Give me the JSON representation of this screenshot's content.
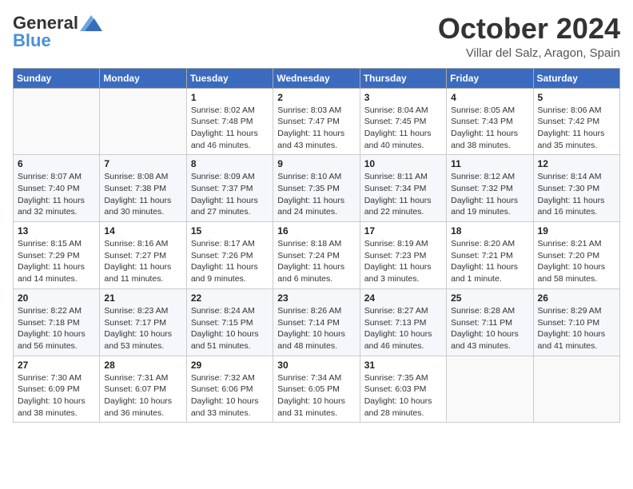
{
  "header": {
    "logo_general": "General",
    "logo_blue": "Blue",
    "month_year": "October 2024",
    "location": "Villar del Salz, Aragon, Spain"
  },
  "days_of_week": [
    "Sunday",
    "Monday",
    "Tuesday",
    "Wednesday",
    "Thursday",
    "Friday",
    "Saturday"
  ],
  "weeks": [
    [
      {
        "day": "",
        "detail": ""
      },
      {
        "day": "",
        "detail": ""
      },
      {
        "day": "1",
        "detail": "Sunrise: 8:02 AM\nSunset: 7:48 PM\nDaylight: 11 hours and 46 minutes."
      },
      {
        "day": "2",
        "detail": "Sunrise: 8:03 AM\nSunset: 7:47 PM\nDaylight: 11 hours and 43 minutes."
      },
      {
        "day": "3",
        "detail": "Sunrise: 8:04 AM\nSunset: 7:45 PM\nDaylight: 11 hours and 40 minutes."
      },
      {
        "day": "4",
        "detail": "Sunrise: 8:05 AM\nSunset: 7:43 PM\nDaylight: 11 hours and 38 minutes."
      },
      {
        "day": "5",
        "detail": "Sunrise: 8:06 AM\nSunset: 7:42 PM\nDaylight: 11 hours and 35 minutes."
      }
    ],
    [
      {
        "day": "6",
        "detail": "Sunrise: 8:07 AM\nSunset: 7:40 PM\nDaylight: 11 hours and 32 minutes."
      },
      {
        "day": "7",
        "detail": "Sunrise: 8:08 AM\nSunset: 7:38 PM\nDaylight: 11 hours and 30 minutes."
      },
      {
        "day": "8",
        "detail": "Sunrise: 8:09 AM\nSunset: 7:37 PM\nDaylight: 11 hours and 27 minutes."
      },
      {
        "day": "9",
        "detail": "Sunrise: 8:10 AM\nSunset: 7:35 PM\nDaylight: 11 hours and 24 minutes."
      },
      {
        "day": "10",
        "detail": "Sunrise: 8:11 AM\nSunset: 7:34 PM\nDaylight: 11 hours and 22 minutes."
      },
      {
        "day": "11",
        "detail": "Sunrise: 8:12 AM\nSunset: 7:32 PM\nDaylight: 11 hours and 19 minutes."
      },
      {
        "day": "12",
        "detail": "Sunrise: 8:14 AM\nSunset: 7:30 PM\nDaylight: 11 hours and 16 minutes."
      }
    ],
    [
      {
        "day": "13",
        "detail": "Sunrise: 8:15 AM\nSunset: 7:29 PM\nDaylight: 11 hours and 14 minutes."
      },
      {
        "day": "14",
        "detail": "Sunrise: 8:16 AM\nSunset: 7:27 PM\nDaylight: 11 hours and 11 minutes."
      },
      {
        "day": "15",
        "detail": "Sunrise: 8:17 AM\nSunset: 7:26 PM\nDaylight: 11 hours and 9 minutes."
      },
      {
        "day": "16",
        "detail": "Sunrise: 8:18 AM\nSunset: 7:24 PM\nDaylight: 11 hours and 6 minutes."
      },
      {
        "day": "17",
        "detail": "Sunrise: 8:19 AM\nSunset: 7:23 PM\nDaylight: 11 hours and 3 minutes."
      },
      {
        "day": "18",
        "detail": "Sunrise: 8:20 AM\nSunset: 7:21 PM\nDaylight: 11 hours and 1 minute."
      },
      {
        "day": "19",
        "detail": "Sunrise: 8:21 AM\nSunset: 7:20 PM\nDaylight: 10 hours and 58 minutes."
      }
    ],
    [
      {
        "day": "20",
        "detail": "Sunrise: 8:22 AM\nSunset: 7:18 PM\nDaylight: 10 hours and 56 minutes."
      },
      {
        "day": "21",
        "detail": "Sunrise: 8:23 AM\nSunset: 7:17 PM\nDaylight: 10 hours and 53 minutes."
      },
      {
        "day": "22",
        "detail": "Sunrise: 8:24 AM\nSunset: 7:15 PM\nDaylight: 10 hours and 51 minutes."
      },
      {
        "day": "23",
        "detail": "Sunrise: 8:26 AM\nSunset: 7:14 PM\nDaylight: 10 hours and 48 minutes."
      },
      {
        "day": "24",
        "detail": "Sunrise: 8:27 AM\nSunset: 7:13 PM\nDaylight: 10 hours and 46 minutes."
      },
      {
        "day": "25",
        "detail": "Sunrise: 8:28 AM\nSunset: 7:11 PM\nDaylight: 10 hours and 43 minutes."
      },
      {
        "day": "26",
        "detail": "Sunrise: 8:29 AM\nSunset: 7:10 PM\nDaylight: 10 hours and 41 minutes."
      }
    ],
    [
      {
        "day": "27",
        "detail": "Sunrise: 7:30 AM\nSunset: 6:09 PM\nDaylight: 10 hours and 38 minutes."
      },
      {
        "day": "28",
        "detail": "Sunrise: 7:31 AM\nSunset: 6:07 PM\nDaylight: 10 hours and 36 minutes."
      },
      {
        "day": "29",
        "detail": "Sunrise: 7:32 AM\nSunset: 6:06 PM\nDaylight: 10 hours and 33 minutes."
      },
      {
        "day": "30",
        "detail": "Sunrise: 7:34 AM\nSunset: 6:05 PM\nDaylight: 10 hours and 31 minutes."
      },
      {
        "day": "31",
        "detail": "Sunrise: 7:35 AM\nSunset: 6:03 PM\nDaylight: 10 hours and 28 minutes."
      },
      {
        "day": "",
        "detail": ""
      },
      {
        "day": "",
        "detail": ""
      }
    ]
  ]
}
